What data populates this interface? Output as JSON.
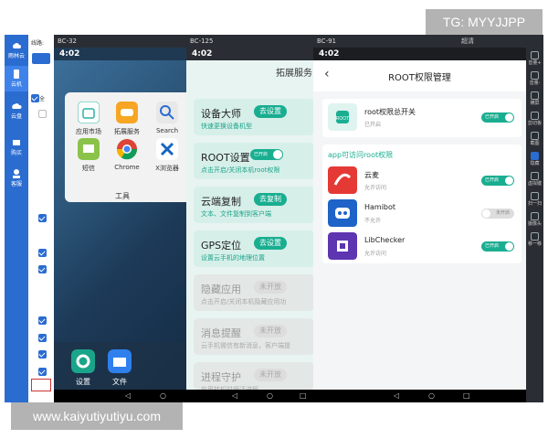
{
  "watermarks": {
    "tg": "TG: MYYJJPP",
    "site": "www.kaiyutiyutiyu.com"
  },
  "sidebar": {
    "logo": "雨林云",
    "items": [
      {
        "label": "云机"
      },
      {
        "label": "云盘"
      },
      {
        "label": "购买"
      },
      {
        "label": "客服"
      }
    ]
  },
  "device_list": {
    "line_label": "线路:",
    "all_label": "全"
  },
  "phone1": {
    "title": "BC-32",
    "time": "4:02",
    "folder": {
      "title": "工具",
      "apps": [
        {
          "label": "应用市场"
        },
        {
          "label": "拓展服务"
        },
        {
          "label": "Search"
        },
        {
          "label": "短信"
        },
        {
          "label": "Chrome"
        },
        {
          "label": "X浏览器"
        }
      ]
    },
    "dock": [
      {
        "label": "设置"
      },
      {
        "label": "文件"
      }
    ]
  },
  "phone2": {
    "title": "BC-125",
    "time": "4:02",
    "header": "拓展服务",
    "cards": [
      {
        "title": "设备大师",
        "sub": "快速更换设备机型",
        "button": "去设置"
      },
      {
        "title": "ROOT设置",
        "sub": "点击开启/关闭本机root权限",
        "toggle": "已开启"
      },
      {
        "title": "云端复制",
        "sub": "文本、文件复制到客户端",
        "button": "去复制"
      },
      {
        "title": "GPS定位",
        "sub": "设置云手机的地理位置",
        "button": "去设置"
      },
      {
        "title": "隐藏应用",
        "sub": "点击开启/关闭本机隐藏应用功",
        "button": "未开放"
      },
      {
        "title": "消息提醒",
        "sub": "云手机微信有新消息，客户端提",
        "button": "未开放"
      },
      {
        "title": "进程守护",
        "sub": "应用挂机时保活进程",
        "button": "未开放"
      }
    ]
  },
  "phone3": {
    "title": "BC-91",
    "time": "4:02",
    "header": "ROOT权限管理",
    "top_select": "超清",
    "master": {
      "name": "root权限总开关",
      "status": "已开启",
      "toggle": "已开启"
    },
    "section": "app可访问root权限",
    "apps": [
      {
        "name": "云麦",
        "status": "允许访问",
        "toggle": "已开启"
      },
      {
        "name": "Hamibot",
        "status": "不允许",
        "toggle": "未开启"
      },
      {
        "name": "LibChecker",
        "status": "允许访问",
        "toggle": "已开启"
      }
    ]
  },
  "toolbar": [
    {
      "label": "音量+"
    },
    {
      "label": "音量-"
    },
    {
      "label": "横屏"
    },
    {
      "label": "剪切板"
    },
    {
      "label": "截图"
    },
    {
      "label": "隐藏"
    },
    {
      "label": "虚拟键"
    },
    {
      "label": "扫一扫"
    },
    {
      "label": "摄像头"
    },
    {
      "label": "移一移"
    }
  ],
  "nav": {
    "back": "◁",
    "home": "○",
    "recent": "□"
  }
}
